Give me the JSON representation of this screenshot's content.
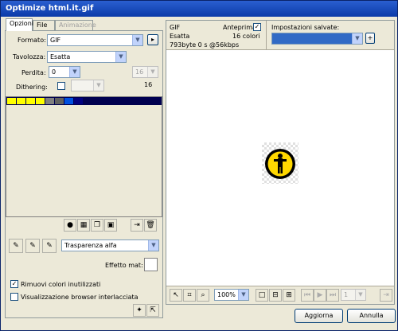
{
  "window": {
    "title": "Optimize html.it.gif"
  },
  "tabs": [
    {
      "label": "Opzioni"
    },
    {
      "label": "File"
    },
    {
      "label": "Animazione"
    }
  ],
  "options": {
    "format_label": "Formato:",
    "format_value": "GIF",
    "palette_label": "Tavolozza:",
    "palette_value": "Esatta",
    "loss_label": "Perdita:",
    "loss_value": "0",
    "dithering_label": "Dithering:",
    "colors_value": "16",
    "colors_count": "16",
    "transparency_value": "Trasparenza alfa",
    "matte_label": "Effetto mat:",
    "remove_unused_label": "Rimuovi colori inutilizzati",
    "interlaced_label": "Visualizzazione browser interlacciata"
  },
  "palette_swatches": [
    "#ffff00",
    "#ffff00",
    "#ffff00",
    "#ffff00",
    "#808080",
    "#606060",
    "#0050e0",
    "#000080"
  ],
  "preview": {
    "format": "GIF",
    "palette": "Esatta",
    "info": "793byte  0 s @56kbps",
    "colors": "16 colori",
    "preview_label": "Anteprima",
    "saved_label": "Impostazioni salvate:"
  },
  "zoom": {
    "value": "100%"
  },
  "frame": {
    "value": "1"
  },
  "buttons": {
    "ok": "Aggiorna",
    "cancel": "Annulla"
  },
  "colors": {
    "title_bg": "#0b3aa8",
    "accent": "#316ac5",
    "palette_bg": "#000050"
  }
}
